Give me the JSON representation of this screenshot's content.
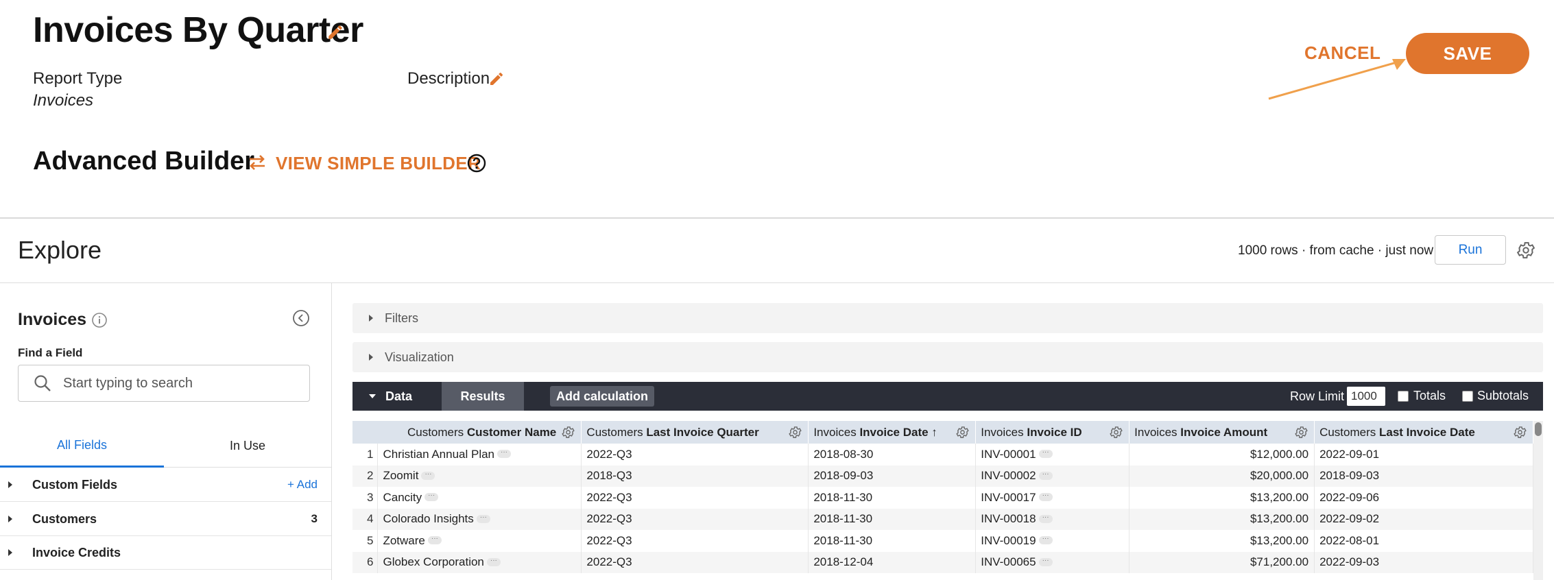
{
  "header": {
    "title": "Invoices By Quarter",
    "report_type_label": "Report Type",
    "report_type_value": "Invoices",
    "description_label": "Description",
    "cancel_label": "CANCEL",
    "save_label": "SAVE"
  },
  "builder": {
    "title": "Advanced Builder",
    "simple_link": "VIEW SIMPLE BUILDER"
  },
  "explore": {
    "title": "Explore",
    "meta": "1000 rows · from cache · just now",
    "run_label": "Run"
  },
  "sidebar": {
    "title": "Invoices",
    "find_label": "Find a Field",
    "search_placeholder": "Start typing to search",
    "tabs": [
      {
        "label": "All Fields",
        "active": true
      },
      {
        "label": "In Use",
        "active": false
      }
    ],
    "groups": [
      {
        "label": "Custom Fields",
        "action": "+ Add"
      },
      {
        "label": "Customers",
        "count": "3"
      },
      {
        "label": "Invoice Credits"
      }
    ]
  },
  "panels": {
    "filters_label": "Filters",
    "visualization_label": "Visualization"
  },
  "databar": {
    "data_tab": "Data",
    "results_tab": "Results",
    "add_calc": "Add calculation",
    "row_limit_label": "Row Limit",
    "row_limit_value": "1000",
    "totals_label": "Totals",
    "subtotals_label": "Subtotals"
  },
  "table": {
    "columns": [
      {
        "prefix": "Customers",
        "name": "Customer Name"
      },
      {
        "prefix": "Customers",
        "name": "Last Invoice Quarter"
      },
      {
        "prefix": "Invoices",
        "name": "Invoice Date ↑"
      },
      {
        "prefix": "Invoices",
        "name": "Invoice ID"
      },
      {
        "prefix": "Invoices",
        "name": "Invoice Amount"
      },
      {
        "prefix": "Customers",
        "name": "Last Invoice Date"
      }
    ],
    "rows": [
      [
        "1",
        "Christian Annual Plan",
        "2022-Q3",
        "2018-08-30",
        "INV-00001",
        "$12,000.00",
        "2022-09-01"
      ],
      [
        "2",
        "Zoomit",
        "2018-Q3",
        "2018-09-03",
        "INV-00002",
        "$20,000.00",
        "2018-09-03"
      ],
      [
        "3",
        "Cancity",
        "2022-Q3",
        "2018-11-30",
        "INV-00017",
        "$13,200.00",
        "2022-09-06"
      ],
      [
        "4",
        "Colorado Insights",
        "2022-Q3",
        "2018-11-30",
        "INV-00018",
        "$13,200.00",
        "2022-09-02"
      ],
      [
        "5",
        "Zotware",
        "2022-Q3",
        "2018-11-30",
        "INV-00019",
        "$13,200.00",
        "2022-08-01"
      ],
      [
        "6",
        "Globex Corporation",
        "2022-Q3",
        "2018-12-04",
        "INV-00065",
        "$71,200.00",
        "2022-09-03"
      ]
    ]
  },
  "colors": {
    "accent": "#e0752d",
    "link": "#1a73d9",
    "databar": "#2b2e38",
    "header_row": "#dce3ec"
  }
}
